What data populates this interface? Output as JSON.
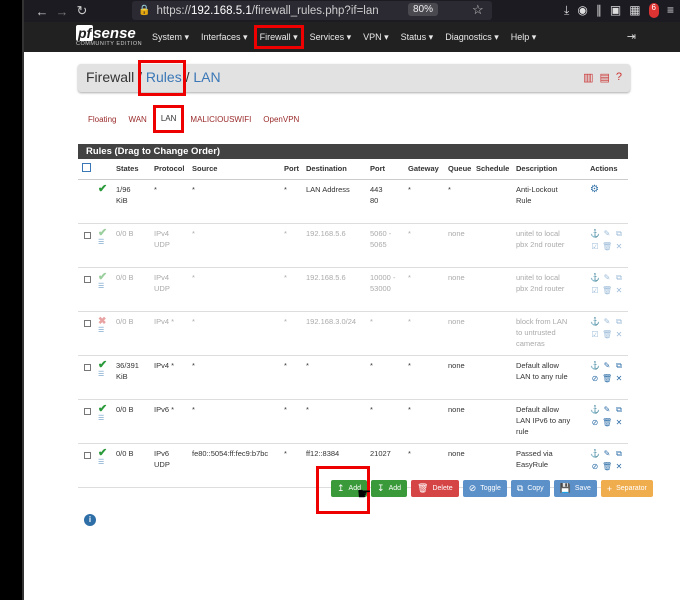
{
  "browser": {
    "url_prefix": "https://",
    "url_host": "192.168.5.1",
    "url_path": "/firewall_rules.php?if=lan",
    "zoom": "80%",
    "notif_count": "6"
  },
  "header": {
    "logo_pf": "pf",
    "logo_sense": "sense",
    "logo_sub": "COMMUNITY EDITION",
    "menu": [
      "System ▾",
      "Interfaces ▾",
      "Firewall ▾",
      "Services ▾",
      "VPN ▾",
      "Status ▾",
      "Diagnostics ▾",
      "Help ▾"
    ]
  },
  "breadcrumb": {
    "first": "Firewall",
    "sep1": " / ",
    "second": "Rules",
    "sep2": " / ",
    "third": "LAN"
  },
  "tabs": [
    "Floating",
    "WAN",
    "LAN",
    "MALICIOUSWIFI",
    "OpenVPN"
  ],
  "table": {
    "title": "Rules (Drag to Change Order)",
    "columns": [
      "",
      "",
      "States",
      "Protocol",
      "Source",
      "Port",
      "Destination",
      "Port",
      "Gateway",
      "Queue",
      "Schedule",
      "Description",
      "Actions"
    ],
    "rows": [
      {
        "state": "ok",
        "states": "1/96\nKiB",
        "protocol": "*",
        "source": "*",
        "sport": "*",
        "dest": "LAN Address",
        "dport": "443\n80",
        "gateway": "*",
        "queue": "*",
        "schedule": "",
        "desc": "Anti-Lockout\nRule",
        "dim": false,
        "anti": true
      },
      {
        "state": "ok",
        "states": "0/0 B",
        "protocol": "IPv4\nUDP",
        "source": "*",
        "sport": "*",
        "dest": "192.168.5.6",
        "dport": "5060 -\n5065",
        "gateway": "*",
        "queue": "none",
        "schedule": "",
        "desc": "unitel to local\npbx 2nd router",
        "dim": true
      },
      {
        "state": "ok",
        "states": "0/0 B",
        "protocol": "IPv4\nUDP",
        "source": "*",
        "sport": "*",
        "dest": "192.168.5.6",
        "dport": "10000 -\n53000",
        "gateway": "*",
        "queue": "none",
        "schedule": "",
        "desc": "unitel to local\npbx 2nd router",
        "dim": true
      },
      {
        "state": "no",
        "states": "0/0 B",
        "protocol": "IPv4 *",
        "source": "*",
        "sport": "*",
        "dest": "192.168.3.0/24",
        "dport": "*",
        "gateway": "*",
        "queue": "none",
        "schedule": "",
        "desc": "block from LAN\nto untrusted\ncameras",
        "dim": true
      },
      {
        "state": "ok",
        "states": "36/391\nKiB",
        "protocol": "IPv4 *",
        "source": "*",
        "sport": "*",
        "dest": "*",
        "dport": "*",
        "gateway": "*",
        "queue": "none",
        "schedule": "",
        "desc": "Default allow\nLAN to any rule",
        "dim": false
      },
      {
        "state": "ok",
        "states": "0/0 B",
        "protocol": "IPv6 *",
        "source": "*",
        "sport": "*",
        "dest": "*",
        "dport": "*",
        "gateway": "*",
        "queue": "none",
        "schedule": "",
        "desc": "Default allow\nLAN IPv6 to any\nrule",
        "dim": false
      },
      {
        "state": "ok",
        "states": "0/0 B",
        "protocol": "IPv6\nUDP",
        "source": "fe80::5054:ff:fec9:b7bc",
        "sport": "*",
        "dest": "ff12::8384",
        "dport": "21027",
        "gateway": "*",
        "queue": "none",
        "schedule": "",
        "desc": "Passed via\nEasyRule",
        "dim": false
      }
    ]
  },
  "buttons": {
    "add_top": "Add",
    "add_bottom": "Add",
    "delete": "Delete",
    "toggle": "Toggle",
    "copy": "Copy",
    "save": "Save",
    "separator": "Separator"
  },
  "colors": {
    "highlight": "#ee0000",
    "header_bg": "#212121",
    "link": "#3a77b7",
    "tab_text": "#9a2b2b"
  }
}
